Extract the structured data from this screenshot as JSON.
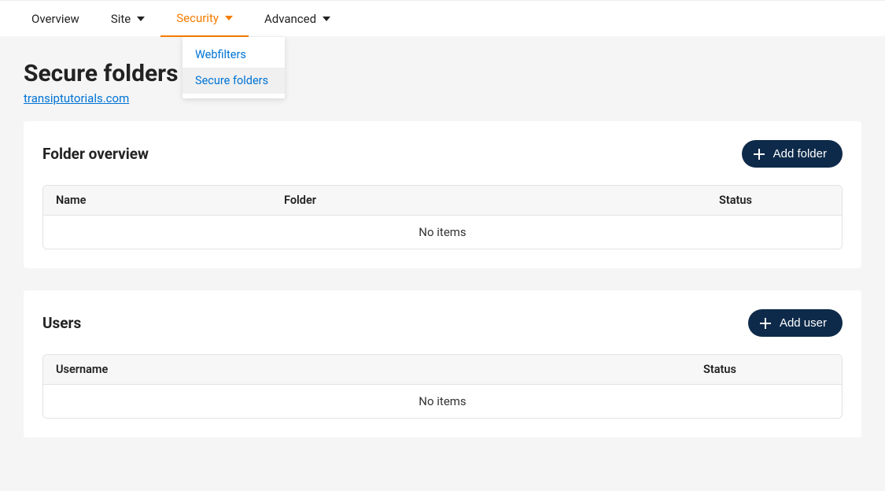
{
  "nav": {
    "items": [
      {
        "label": "Overview",
        "hasCaret": false,
        "active": false
      },
      {
        "label": "Site",
        "hasCaret": true,
        "active": false
      },
      {
        "label": "Security",
        "hasCaret": true,
        "active": true
      },
      {
        "label": "Advanced",
        "hasCaret": true,
        "active": false
      }
    ]
  },
  "dropdown": {
    "items": [
      {
        "label": "Webfilters",
        "highlight": false
      },
      {
        "label": "Secure folders",
        "highlight": true
      }
    ]
  },
  "header": {
    "title": "Secure folders",
    "subtitle": "transiptutorials.com"
  },
  "folder_panel": {
    "title": "Folder overview",
    "button_label": "Add folder",
    "columns": {
      "name": "Name",
      "folder": "Folder",
      "status": "Status"
    },
    "empty_text": "No items"
  },
  "users_panel": {
    "title": "Users",
    "button_label": "Add user",
    "columns": {
      "username": "Username",
      "status": "Status"
    },
    "empty_text": "No items"
  }
}
